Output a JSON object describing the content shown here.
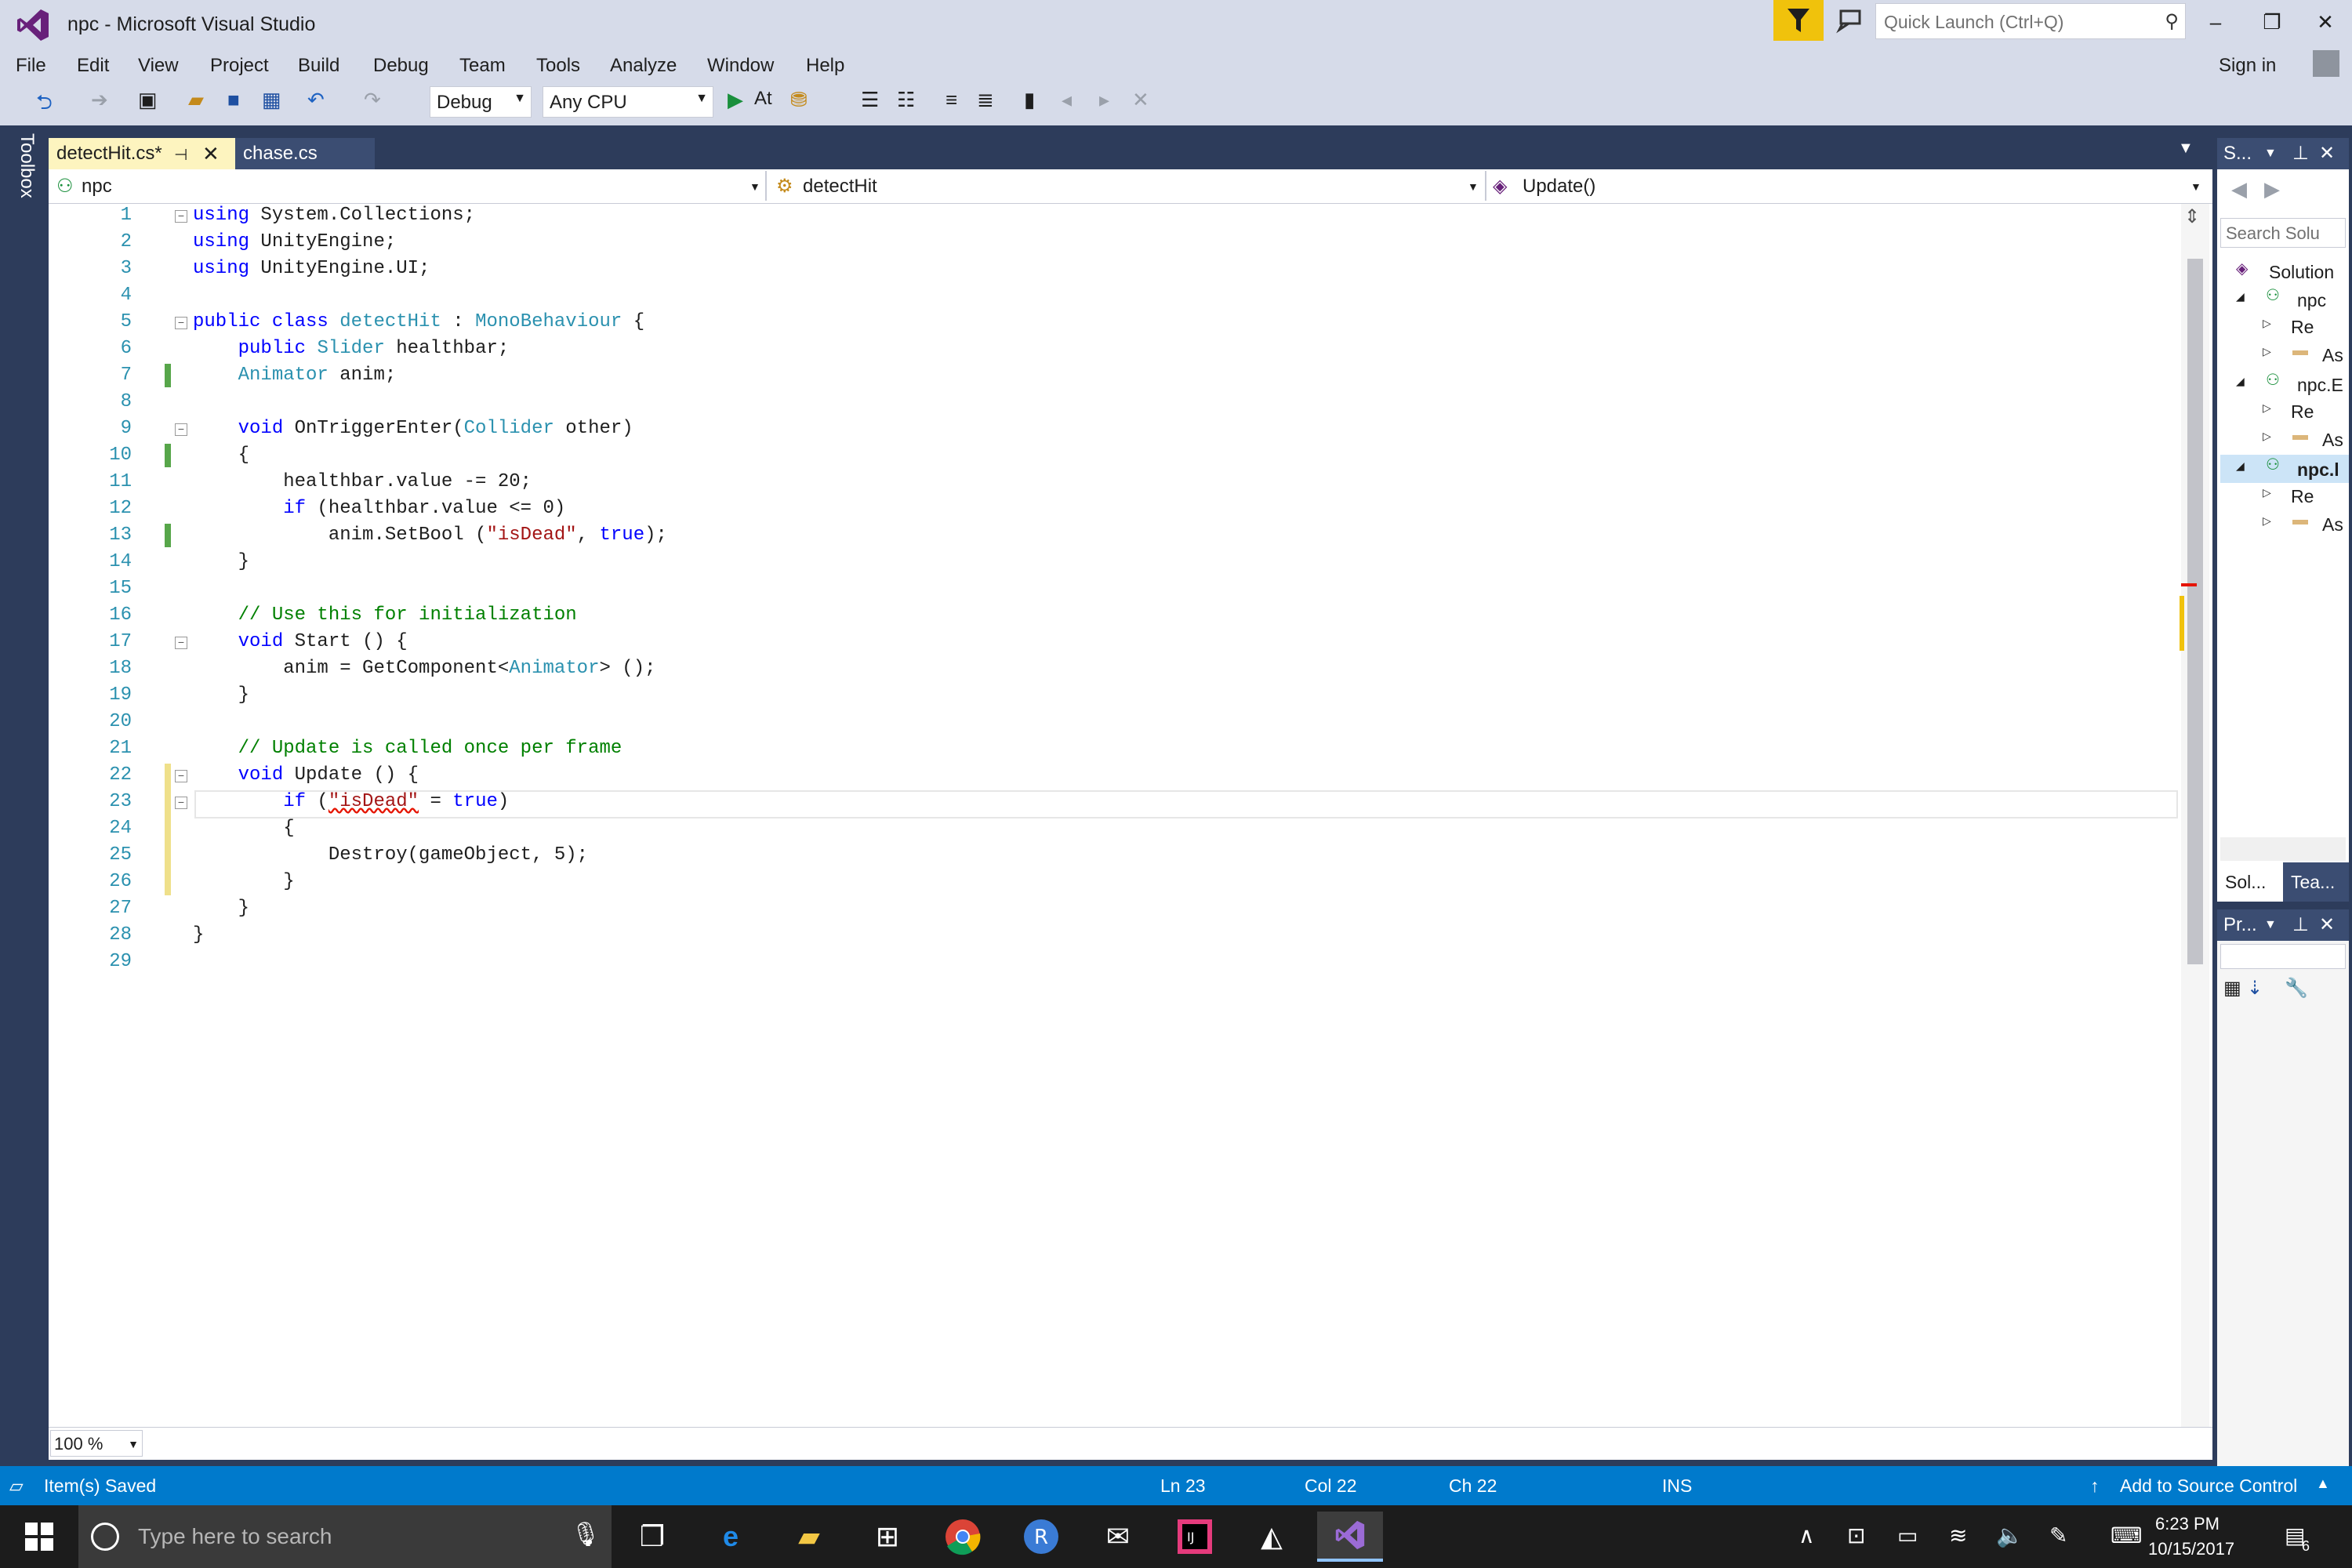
{
  "window": {
    "title": "npc - Microsoft Visual Studio",
    "minimize": "‒",
    "restore": "❐",
    "close": "✕"
  },
  "quick_launch": {
    "placeholder": "Quick Launch (Ctrl+Q)"
  },
  "menu": [
    "File",
    "Edit",
    "View",
    "Project",
    "Build",
    "Debug",
    "Team",
    "Tools",
    "Analyze",
    "Window",
    "Help"
  ],
  "signin": "Sign in",
  "toolbar": {
    "config": "Debug",
    "platform": "Any CPU",
    "start_label": "At"
  },
  "toolbox_label": "Toolbox",
  "tabs": [
    {
      "label": "detectHit.cs*",
      "active": true
    },
    {
      "label": "chase.cs",
      "active": false
    }
  ],
  "navbar": {
    "project": "npc",
    "class": "detectHit",
    "member": "Update()"
  },
  "code": {
    "lines": [
      "1",
      "2",
      "3",
      "4",
      "5",
      "6",
      "7",
      "8",
      "9",
      "10",
      "11",
      "12",
      "13",
      "14",
      "15",
      "16",
      "17",
      "18",
      "19",
      "20",
      "21",
      "22",
      "23",
      "24",
      "25",
      "26",
      "27",
      "28",
      "29"
    ]
  },
  "zoom": "100 %",
  "solution_explorer": {
    "title": "S...",
    "search_placeholder": "Search Solu",
    "items": [
      "Solution",
      "npc",
      "Re",
      "As",
      "npc.E",
      "Re",
      "As",
      "npc.l",
      "Re",
      "As"
    ],
    "tabs": [
      "Sol...",
      "Tea..."
    ]
  },
  "properties": {
    "title": "Pr..."
  },
  "status": {
    "message": "Item(s) Saved",
    "ln": "Ln 23",
    "col": "Col 22",
    "ch": "Ch 22",
    "mode": "INS",
    "source_control": "Add to Source Control"
  },
  "taskbar": {
    "search_placeholder": "Type here to search",
    "time": "6:23 PM",
    "date": "10/15/2017",
    "notification_count": "6"
  },
  "colors": {
    "accent": "#007acc",
    "tab_active": "#fdf4bf",
    "chrome": "#d6dbe9",
    "dark": "#2d3c5b"
  }
}
